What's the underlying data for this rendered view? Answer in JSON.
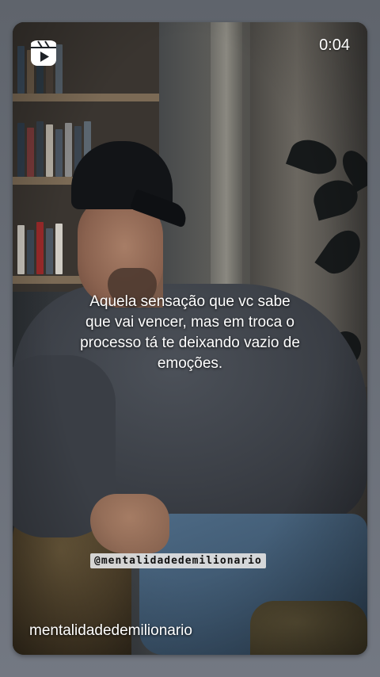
{
  "post": {
    "duration": "0:04",
    "caption": "Aquela sensação que vc sabe que vai vencer, mas em troca o processo tá te deixando vazio de emoções.",
    "watermark": "@mentalidadedemilionario",
    "account_name": "mentalidadedemilionario",
    "platform_icon": "reels-icon"
  },
  "colors": {
    "page_background": "#6b7079",
    "overlay_text": "#ffffff",
    "watermark_background": "#e2e2e2",
    "watermark_text": "#111111"
  }
}
